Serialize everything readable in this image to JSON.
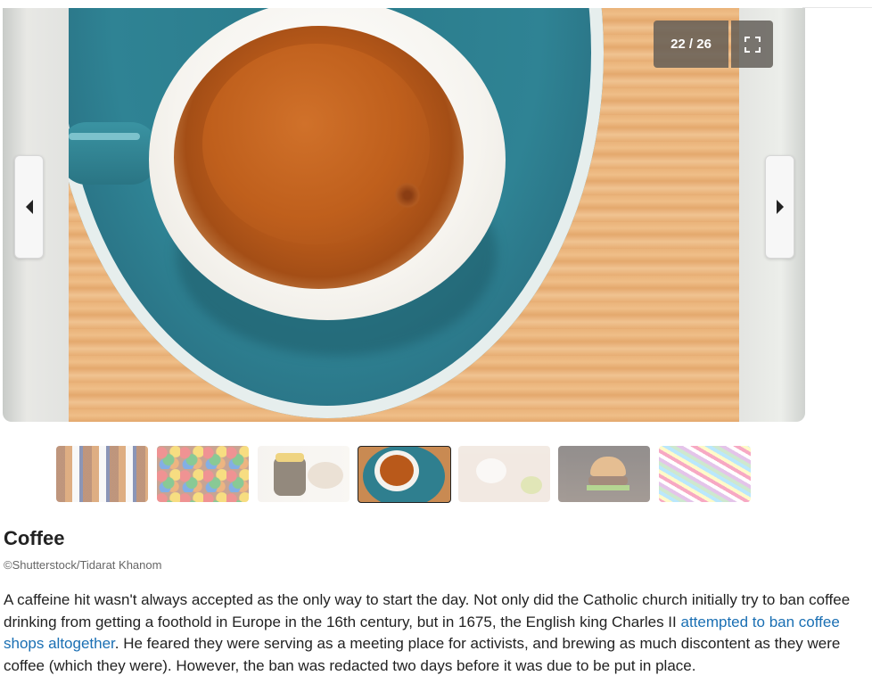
{
  "gallery": {
    "counter": "22 / 26",
    "prev_icon": "caret-left-icon",
    "next_icon": "caret-right-icon",
    "fullscreen_icon": "fullscreen-icon",
    "photo": "coffee-cup-top-view"
  },
  "thumbnails": [
    {
      "subject": "bottled-drinks"
    },
    {
      "subject": "candies"
    },
    {
      "subject": "marmite-jar"
    },
    {
      "subject": "coffee",
      "active": true
    },
    {
      "subject": "dumplings"
    },
    {
      "subject": "burger"
    },
    {
      "subject": "sprinkles"
    }
  ],
  "article": {
    "title": "Coffee",
    "credit": "©Shutterstock/Tidarat Khanom",
    "text_before": "A caffeine hit wasn't always accepted as the only way to start the day. Not only did the Catholic church initially try to ban coffee drinking from getting a foothold in Europe in the 16th century, but in 1675, the English king Charles II ",
    "link_text": "attempted to ban coffee shops altogether",
    "text_after": ". He feared they were serving as a meeting place for activists, and brewing as much discontent as they were coffee (which they were). However, the ban was redacted two days before it was due to be put in place.",
    "link_color": "#1a6fb3"
  }
}
